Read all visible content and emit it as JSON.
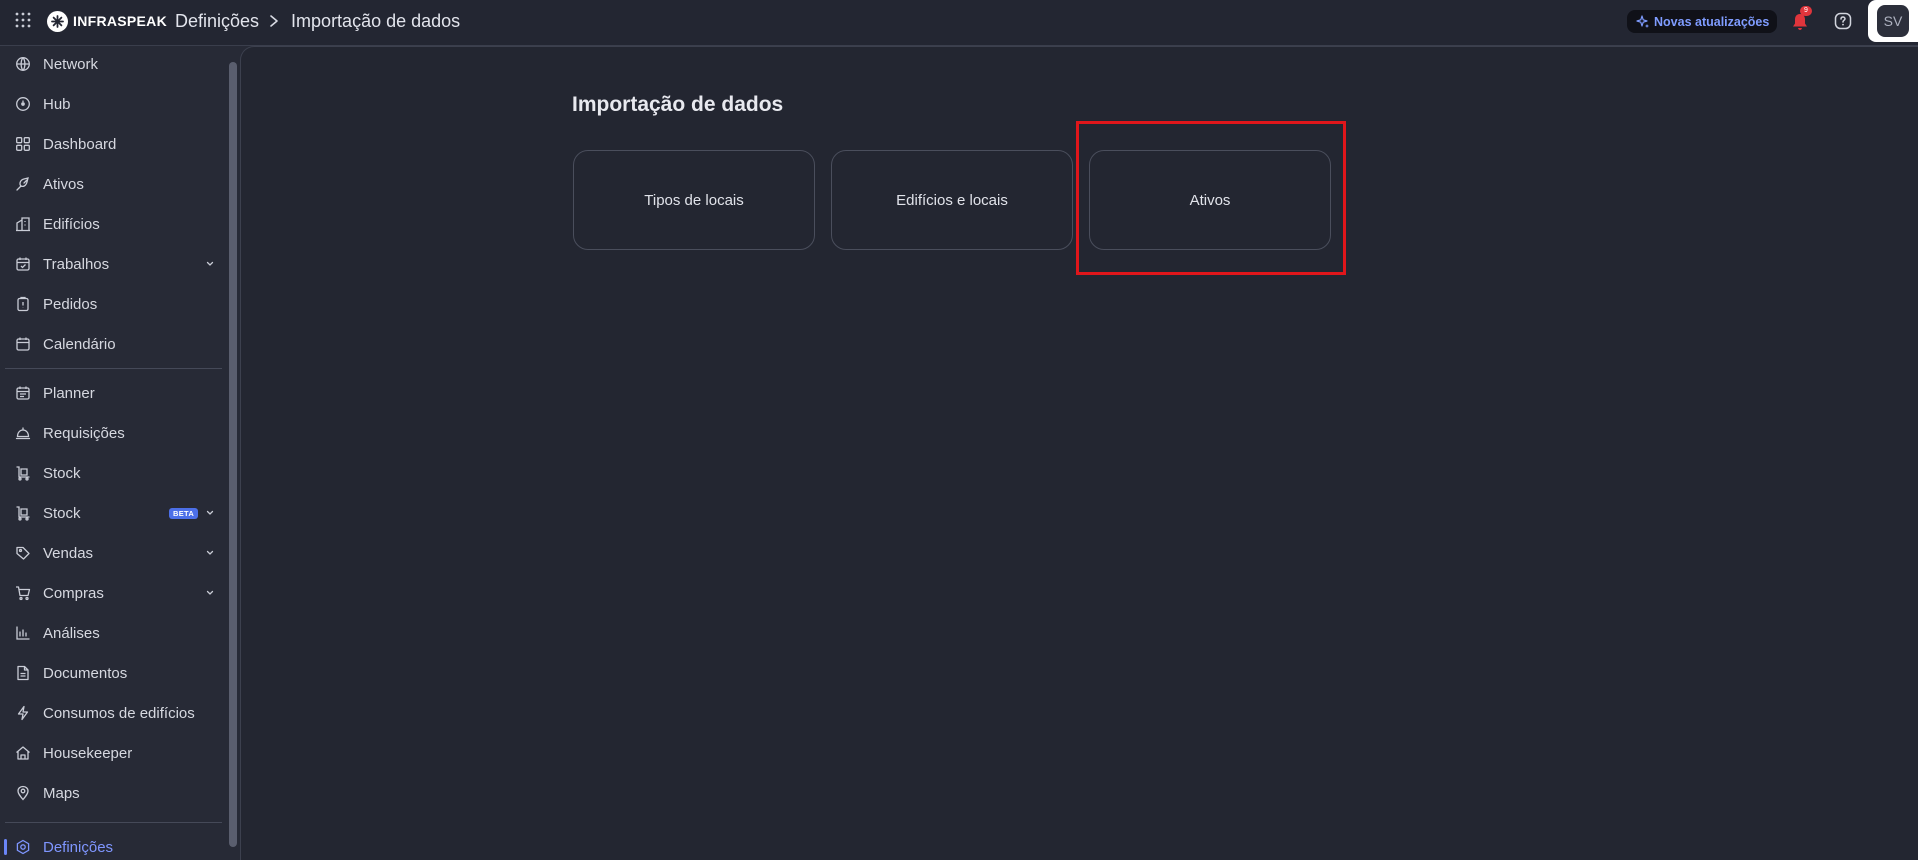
{
  "header": {
    "logo_text": "INFRASPEAK",
    "breadcrumb": [
      "Definições",
      "Importação de dados"
    ],
    "updates_label": "Novas atualizações",
    "notification_count": "9",
    "avatar_initials": "SV"
  },
  "sidebar": {
    "items": [
      {
        "label": "Network",
        "icon": "globe-icon"
      },
      {
        "label": "Hub",
        "icon": "hub-icon"
      },
      {
        "label": "Dashboard",
        "icon": "dashboard-icon"
      },
      {
        "label": "Ativos",
        "icon": "assets-icon"
      },
      {
        "label": "Edifícios",
        "icon": "buildings-icon"
      },
      {
        "label": "Trabalhos",
        "icon": "calendar-work-icon",
        "expandable": true
      },
      {
        "label": "Pedidos",
        "icon": "clipboard-icon"
      },
      {
        "label": "Calendário",
        "icon": "calendar-icon"
      },
      {
        "label": "Planner",
        "icon": "planner-icon"
      },
      {
        "label": "Requisições",
        "icon": "bell-service-icon"
      },
      {
        "label": "Stock",
        "icon": "stock-icon"
      },
      {
        "label": "Stock",
        "icon": "stock-icon",
        "badge": "BETA",
        "expandable": true
      },
      {
        "label": "Vendas",
        "icon": "tag-icon",
        "expandable": true
      },
      {
        "label": "Compras",
        "icon": "cart-icon",
        "expandable": true
      },
      {
        "label": "Análises",
        "icon": "bar-chart-icon"
      },
      {
        "label": "Documentos",
        "icon": "document-icon"
      },
      {
        "label": "Consumos de edifícios",
        "icon": "lightning-icon"
      },
      {
        "label": "Housekeeper",
        "icon": "housekeeper-icon"
      },
      {
        "label": "Maps",
        "icon": "map-pin-icon"
      },
      {
        "label": "Definições",
        "icon": "settings-icon",
        "active": true
      }
    ]
  },
  "main": {
    "title": "Importação de dados",
    "cards": [
      "Tipos de locais",
      "Edifícios e locais",
      "Ativos"
    ]
  },
  "colors": {
    "background": "#272a36",
    "panel": "#232631",
    "accent": "#7f96ff",
    "highlight": "#e0161b",
    "notification": "#e0353c"
  }
}
